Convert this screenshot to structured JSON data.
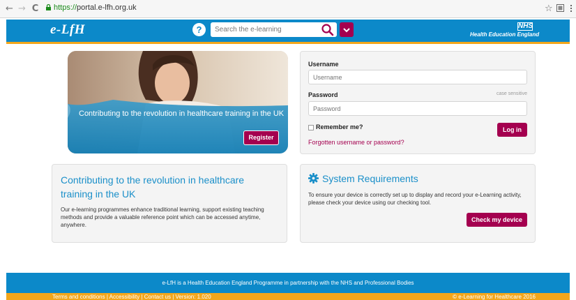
{
  "browser": {
    "back_glyph": "←",
    "forward_glyph": "→",
    "reload_glyph": "C",
    "url_scheme": "https://",
    "url_host": "portal.e-lfh.org.uk",
    "star_glyph": "☆"
  },
  "header": {
    "logo_text": "e-LfH",
    "help_glyph": "?",
    "search_placeholder": "Search the e-learning",
    "nhs_badge": "NHS",
    "nhs_text": "Health Education England"
  },
  "hero": {
    "tagline": "Contributing to the revolution in healthcare training in the UK",
    "register_label": "Register"
  },
  "login": {
    "username_label": "Username",
    "username_placeholder": "Username",
    "password_label": "Password",
    "password_placeholder": "Password",
    "case_note": "case sensitive",
    "remember_label": "Remember me?",
    "remember_checked": false,
    "login_label": "Log in",
    "forgot_label": "Forgotten username or password?"
  },
  "info_panel": {
    "title": "Contributing to the revolution in healthcare training in the UK",
    "body": "Our e-learning programmes enhance traditional learning, support existing teaching methods and provide a valuable reference point which can be accessed anytime, anywhere."
  },
  "requirements_panel": {
    "title": "System Requirements",
    "body": "To ensure your device is correctly set up to display and record your e-Learning activity, please check your device using our checking tool.",
    "button_label": "Check my device"
  },
  "footer": {
    "programme_text": "e-LfH is a Health Education England Programme in partnership with the NHS and Professional Bodies",
    "links_text": "Terms and conditions | Accessibility | Contact us | Version: 1.020",
    "copyright": "© e-Learning for Healthcare 2016"
  },
  "colors": {
    "brand_blue": "#0c89c9",
    "accent_magenta": "#a4004f",
    "gold": "#f3a61b"
  }
}
